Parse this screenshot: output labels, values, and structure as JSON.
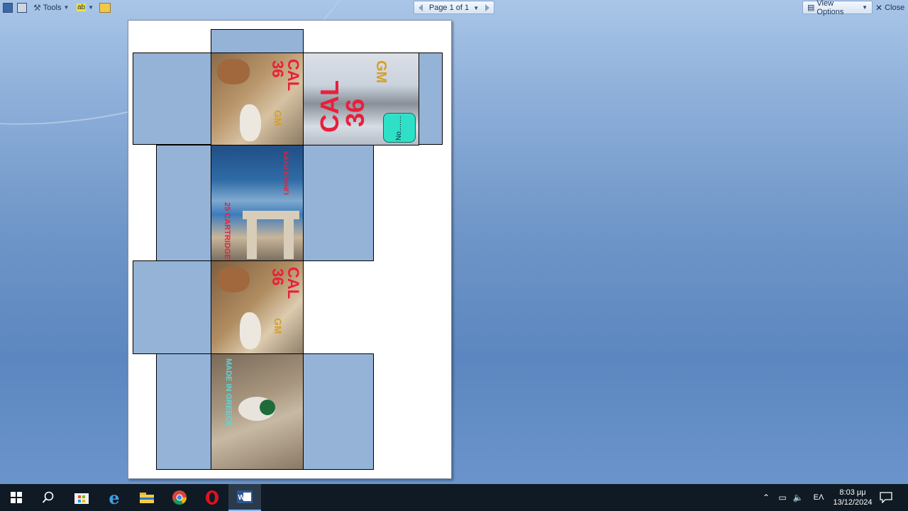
{
  "toolbar": {
    "tools_label": "Tools",
    "spell_label": "ab",
    "page_nav_label": "Page 1 of 1",
    "view_options_label": "View Options",
    "close_label": "Close"
  },
  "panels": {
    "top_center": {
      "cal": "CAL",
      "num": "36",
      "gm": "GM"
    },
    "top_right": {
      "cal": "CAL",
      "num": "36",
      "gm": "GM",
      "badge": "No........"
    },
    "middle": {
      "cartridges": "25 CARTRIDGES",
      "red_text": "ΚΑΛΟ ΚΥΝΗΓΙ"
    },
    "lower_center": {
      "cal": "CAL",
      "num": "36",
      "gm": "GM"
    },
    "bottom": {
      "made_in": "MADE IN GREECE"
    }
  },
  "taskbar": {
    "language": "ΕΛ",
    "time": "8:03 μμ",
    "date": "13/12/2024"
  },
  "colors": {
    "box_fill": "#95b3d7",
    "red_text": "#e8203a",
    "gold_text": "#d4a02a",
    "badge": "#2ee0c8",
    "cyan_text": "#5fd6d8"
  }
}
